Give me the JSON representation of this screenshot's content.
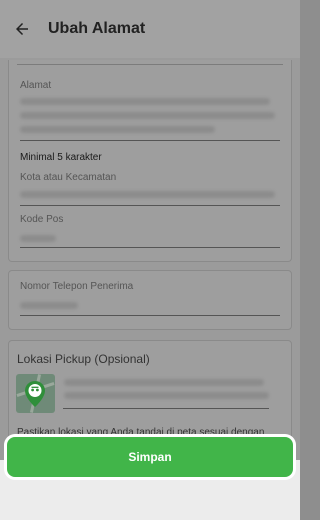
{
  "header": {
    "title": "Ubah Alamat",
    "back_icon": "arrow-left-icon"
  },
  "address_form": {
    "address": {
      "label": "Alamat",
      "hint": "Minimal 5 karakter"
    },
    "city": {
      "label": "Kota atau Kecamatan"
    },
    "postal_code": {
      "label": "Kode Pos"
    }
  },
  "phone": {
    "label": "Nomor Telepon Penerima"
  },
  "pickup": {
    "title": "Lokasi Pickup (Opsional)",
    "note": "Pastikan lokasi yang Anda tandai di peta sesuai dengan alamat yang Anda isi di atas",
    "icon": "map-pin-icon"
  },
  "actions": {
    "save_label": "Simpan"
  },
  "colors": {
    "accent": "#41b549",
    "overlay": "#9b9b9b"
  }
}
